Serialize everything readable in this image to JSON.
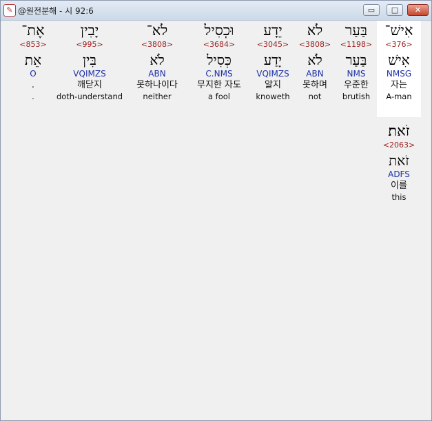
{
  "window": {
    "title": "@원전분해 - 시 92:6",
    "minimize_label": "▭",
    "maximize_label": "□",
    "close_label": "✕"
  },
  "words": [
    {
      "hebrew": "אִישׁ־",
      "strong": "<376>",
      "root": "אִישׁ",
      "morph": "NMSG",
      "korean": "자는",
      "english": "A-man"
    },
    {
      "hebrew": "בַּעַר",
      "strong": "<1198>",
      "root": "בַּעַר",
      "morph": "NMS",
      "korean": "우준한",
      "english": "brutish"
    },
    {
      "hebrew": "לֹא",
      "strong": "<3808>",
      "root": "לֹא",
      "morph": "ABN",
      "korean": "못하며",
      "english": "not"
    },
    {
      "hebrew": "יֵדָע",
      "strong": "<3045>",
      "root": "יָדַע",
      "morph": "VQIMZS",
      "korean": "알지",
      "english": "knoweth"
    },
    {
      "hebrew": "וּכְסִיל",
      "strong": "<3684>",
      "root": "כְּסִיל",
      "morph": "C.NMS",
      "korean": "무지한 자도",
      "english": "a fool"
    },
    {
      "hebrew": "לֹא־",
      "strong": "<3808>",
      "root": "לֹא",
      "morph": "ABN",
      "korean": "못하나이다",
      "english": "neither"
    },
    {
      "hebrew": "יָבִין",
      "strong": "<995>",
      "root": "בִּין",
      "morph": "VQIMZS",
      "korean": "깨닫지",
      "english": "doth-understand"
    },
    {
      "hebrew": "אֶת־",
      "strong": "<853>",
      "root": "אֵת",
      "morph": "O",
      "korean": ".",
      "english": "."
    },
    {
      "hebrew": "זֹאת׃",
      "strong": "<2063>",
      "root": "זֹאת",
      "morph": "ADFS",
      "korean": "이를",
      "english": "this"
    }
  ]
}
